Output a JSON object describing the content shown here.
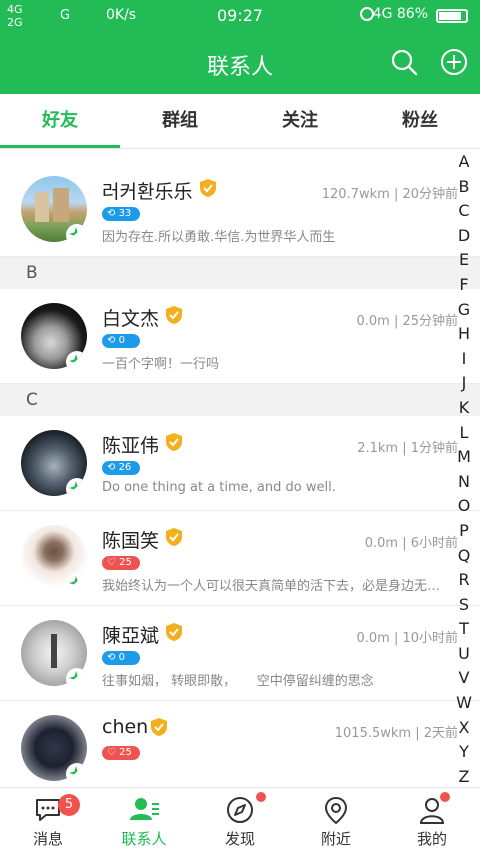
{
  "status": {
    "net_top": "4G",
    "net_bottom": "2G",
    "net2": "G",
    "speed": "0K/s",
    "time": "09:27",
    "signal": "4G",
    "battery": "86%",
    "battery_level": 0.86
  },
  "header": {
    "title": "联系人",
    "search_icon": "search-icon",
    "add_icon": "plus-circle-icon"
  },
  "tabs": [
    {
      "label": "好友",
      "active": true
    },
    {
      "label": "群组"
    },
    {
      "label": "关注"
    },
    {
      "label": "粉丝"
    }
  ],
  "sections": [
    {
      "letter": ""
    },
    {
      "letter": "B"
    },
    {
      "letter": "C"
    }
  ],
  "contacts": [
    {
      "name": "러커환乐乐",
      "meta": "120.7wkm | 20分钟前",
      "pill": "33",
      "pill_color": "blue",
      "signature": "因为存在.所以勇敢.华信.为世界华人而生",
      "badge": "1"
    },
    {
      "name": "白文杰",
      "meta": "0.0m | 25分钟前",
      "pill": "0",
      "pill_color": "blue",
      "signature": "一百个字啊！一行吗",
      "badge": "1"
    },
    {
      "name": "陈亚伟",
      "meta": "2.1km | 1分钟前",
      "pill": "26",
      "pill_color": "blue",
      "signature": "Do one thing at a time, and do well.",
      "badge": "1"
    },
    {
      "name": "陈国笑",
      "meta": "0.0m | 6小时前",
      "pill": "25",
      "pill_color": "red",
      "signature": "我始终认为一个人可以很天真简单的活下去，必是身边无…",
      "badge": "1"
    },
    {
      "name": "陳亞斌",
      "meta": "0.0m | 10小时前",
      "pill": "0",
      "pill_color": "blue",
      "signature": "往事如烟， 转眼即散，     空中停留纠缠的思念",
      "badge": "1"
    },
    {
      "name": "chen",
      "meta": "1015.5wkm | 2天前",
      "pill": "25",
      "pill_color": "red",
      "signature": "",
      "badge": "1"
    }
  ],
  "index_letters": [
    "A",
    "B",
    "C",
    "D",
    "E",
    "F",
    "G",
    "H",
    "I",
    "J",
    "K",
    "L",
    "M",
    "N",
    "O",
    "P",
    "Q",
    "R",
    "S",
    "T",
    "U",
    "V",
    "W",
    "X",
    "Y",
    "Z"
  ],
  "bottom_nav": [
    {
      "label": "消息",
      "icon": "message-icon",
      "count": "5"
    },
    {
      "label": "联系人",
      "icon": "contacts-icon",
      "active": true
    },
    {
      "label": "发现",
      "icon": "compass-icon",
      "dot": true
    },
    {
      "label": "附近",
      "icon": "location-pin-icon"
    },
    {
      "label": "我的",
      "icon": "person-icon",
      "dot": true
    }
  ],
  "colors": {
    "brand": "#22bb55",
    "badge_red": "#ef5350",
    "pill_blue": "#1e9be8",
    "verified": "#f2b01e"
  }
}
